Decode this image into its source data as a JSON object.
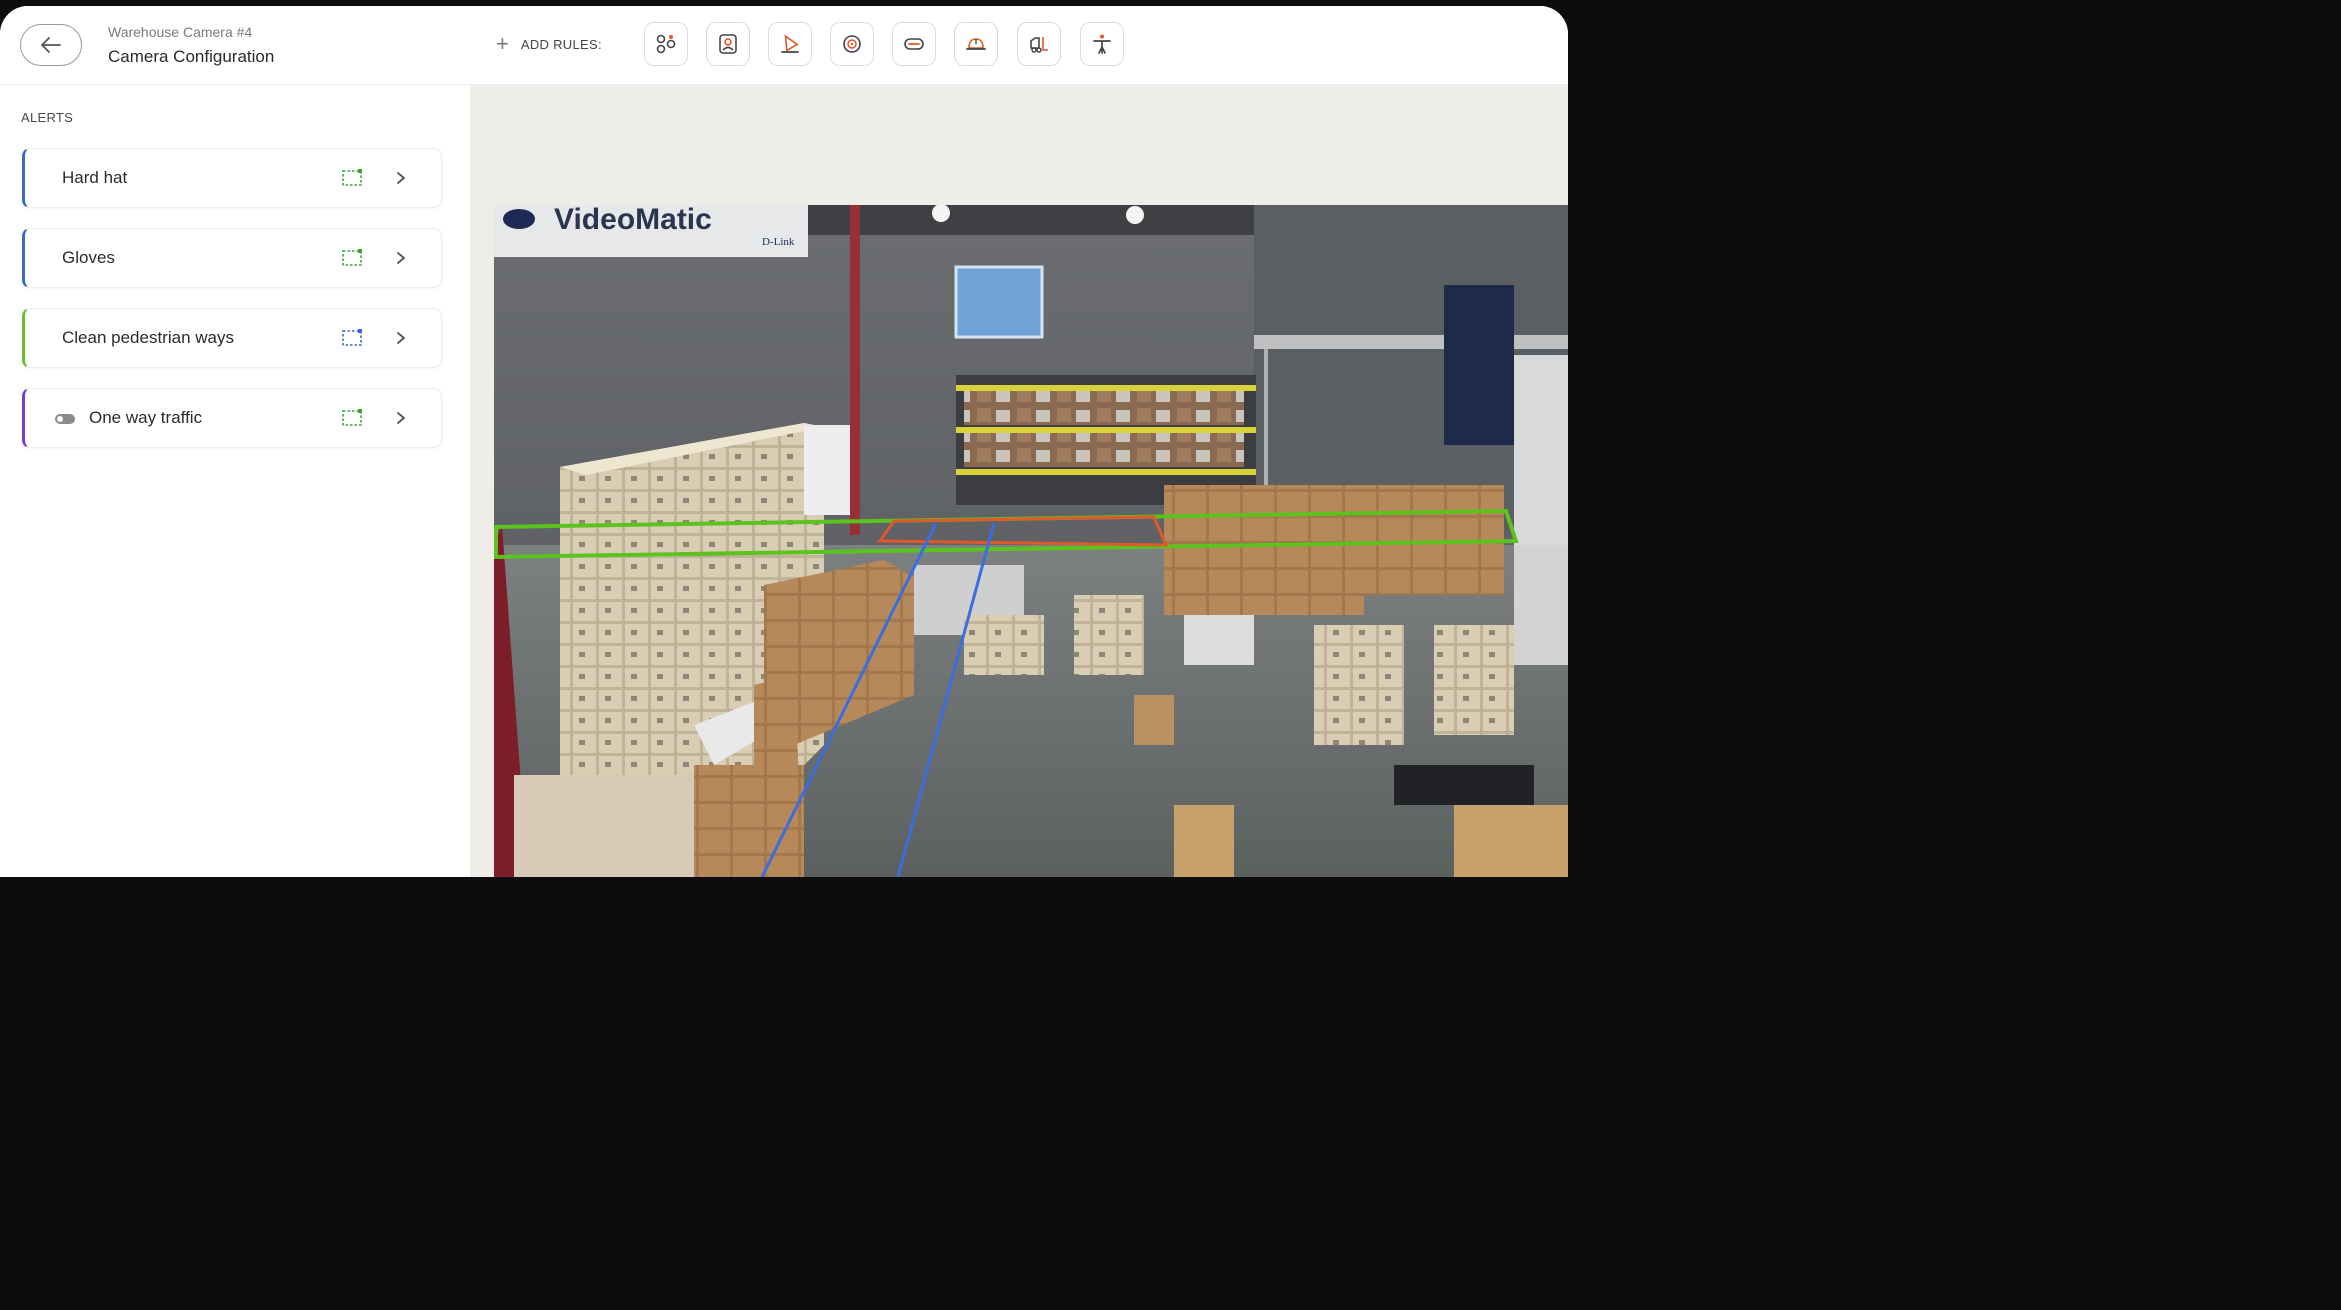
{
  "header": {
    "subtitle": "Warehouse Camera #4",
    "title": "Camera Configuration",
    "add_rules_label": "ADD RULES:",
    "rule_icons": [
      "cluster-icon",
      "person-badge-icon",
      "cone-icon",
      "face-scan-icon",
      "goggles-icon",
      "hard-hat-icon",
      "forklift-icon",
      "person-arms-icon"
    ]
  },
  "sidebar": {
    "section_label": "ALERTS",
    "alerts": [
      {
        "label": "Hard hat",
        "color": "#3a66d6",
        "zone_color": "#3aa832",
        "toggle": false
      },
      {
        "label": "Gloves",
        "color": "#3a66d6",
        "zone_color": "#3aa832",
        "toggle": false
      },
      {
        "label": "Clean pedestrian ways",
        "color": "#6cbf2b",
        "zone_color": "#3a66d6",
        "toggle": false
      },
      {
        "label": "One way traffic",
        "color": "#7a3ae0",
        "zone_color": "#3aa832",
        "toggle": true
      }
    ]
  },
  "camera": {
    "banner_text": "D-Link",
    "zones": {
      "green_zone_color": "#5cc21e",
      "orange_zone_color": "#e0592a",
      "blue_lane_color": "#3a6ee0"
    }
  },
  "colors": {
    "background_main": "#efede8",
    "accent_blue": "#3a66d6",
    "accent_green": "#6cbf2b",
    "accent_purple": "#7a3ae0"
  }
}
